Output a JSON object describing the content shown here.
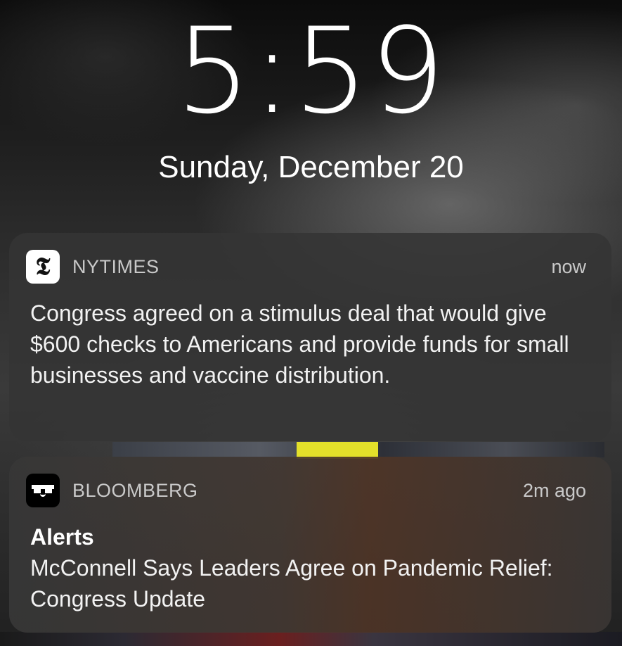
{
  "lockscreen": {
    "time": "5:59",
    "date": "Sunday, December 20"
  },
  "notifications": [
    {
      "app": "NYTIMES",
      "icon": "nytimes-logo-icon",
      "icon_glyph": "𝕿",
      "time_ago": "now",
      "title": "",
      "body": "Congress agreed on a stimulus deal that would give $600 checks to Americans and provide funds for small businesses and vaccine distribution."
    },
    {
      "app": "BLOOMBERG",
      "icon": "bloomberg-logo-icon",
      "time_ago": "2m ago",
      "title": "Alerts",
      "body": "McConnell Says Leaders Agree on Pandemic Relief: Congress Update"
    }
  ],
  "colors": {
    "notification_background": "#343434",
    "secondary_text": "#c9c9c9",
    "primary_text": "#ffffff"
  }
}
